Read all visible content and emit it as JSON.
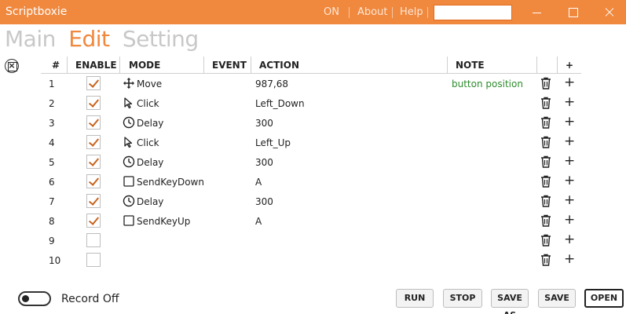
{
  "titlebar": {
    "title": "Scriptboxie",
    "links": [
      "ON",
      "About",
      "Help"
    ],
    "search_value": ""
  },
  "menu": {
    "tabs": [
      "Main",
      "Edit",
      "Setting"
    ],
    "active": "Edit"
  },
  "table": {
    "headers": [
      "#",
      "ENABLE",
      "MODE",
      "EVENT",
      "ACTION",
      "NOTE",
      "",
      "+"
    ],
    "rows": [
      {
        "index": "1",
        "enabled": true,
        "mode": "Move",
        "icon": "move-icon",
        "event": "",
        "action": "987,68",
        "note": "button position"
      },
      {
        "index": "2",
        "enabled": true,
        "mode": "Click",
        "icon": "cursor-icon",
        "event": "",
        "action": "Left_Down",
        "note": ""
      },
      {
        "index": "3",
        "enabled": true,
        "mode": "Delay",
        "icon": "clock-icon",
        "event": "",
        "action": "300",
        "note": ""
      },
      {
        "index": "4",
        "enabled": true,
        "mode": "Click",
        "icon": "cursor-icon",
        "event": "",
        "action": "Left_Up",
        "note": ""
      },
      {
        "index": "5",
        "enabled": true,
        "mode": "Delay",
        "icon": "clock-icon",
        "event": "",
        "action": "300",
        "note": ""
      },
      {
        "index": "6",
        "enabled": true,
        "mode": "SendKeyDown",
        "icon": "square-icon",
        "event": "",
        "action": "A",
        "note": ""
      },
      {
        "index": "7",
        "enabled": true,
        "mode": "Delay",
        "icon": "clock-icon",
        "event": "",
        "action": "300",
        "note": ""
      },
      {
        "index": "8",
        "enabled": true,
        "mode": "SendKeyUp",
        "icon": "square-icon",
        "event": "",
        "action": "A",
        "note": ""
      },
      {
        "index": "9",
        "enabled": false,
        "mode": "",
        "icon": "",
        "event": "",
        "action": "",
        "note": ""
      },
      {
        "index": "10",
        "enabled": false,
        "mode": "",
        "icon": "",
        "event": "",
        "action": "",
        "note": ""
      }
    ]
  },
  "footer": {
    "record_label": "Record Off",
    "buttons": [
      "RUN",
      "STOP",
      "SAVE AS",
      "SAVE",
      "OPEN"
    ]
  },
  "colors": {
    "accent": "#f0883e",
    "note_text": "#2e8b2e",
    "check": "#c8641e"
  }
}
